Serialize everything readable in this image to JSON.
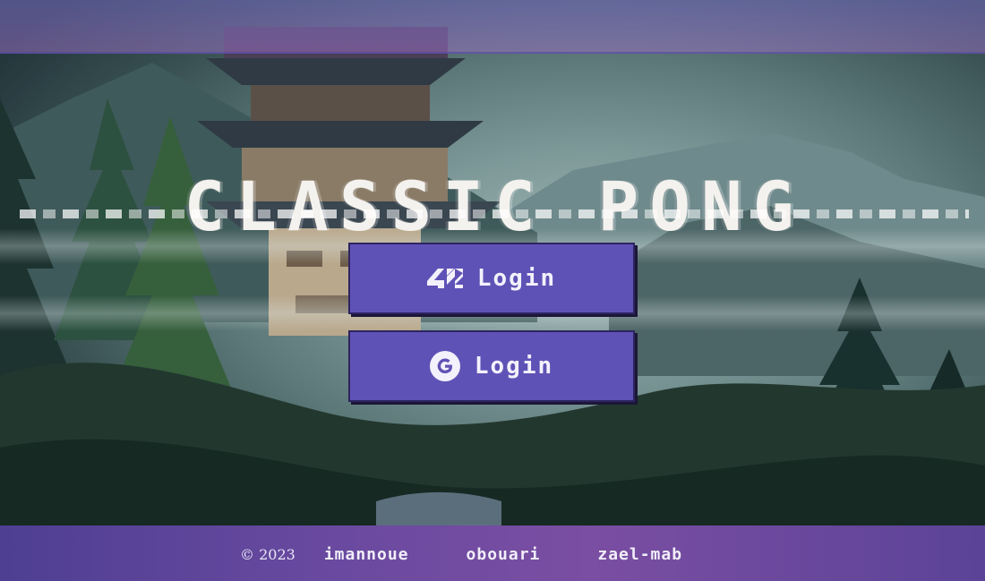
{
  "title": "CLASSIC PONG",
  "buttons": {
    "login_42": {
      "label": "Login",
      "icon": "42-logo-icon"
    },
    "login_google": {
      "label": "Login",
      "icon": "google-icon"
    }
  },
  "footer": {
    "copyright": "© 2023",
    "authors": [
      "imannoue",
      "obouari",
      "zael-mab"
    ]
  },
  "colors": {
    "button_bg": "#5f52b6",
    "footer_bg": "#6a4aa0",
    "title_text": "#f4f2ee"
  }
}
